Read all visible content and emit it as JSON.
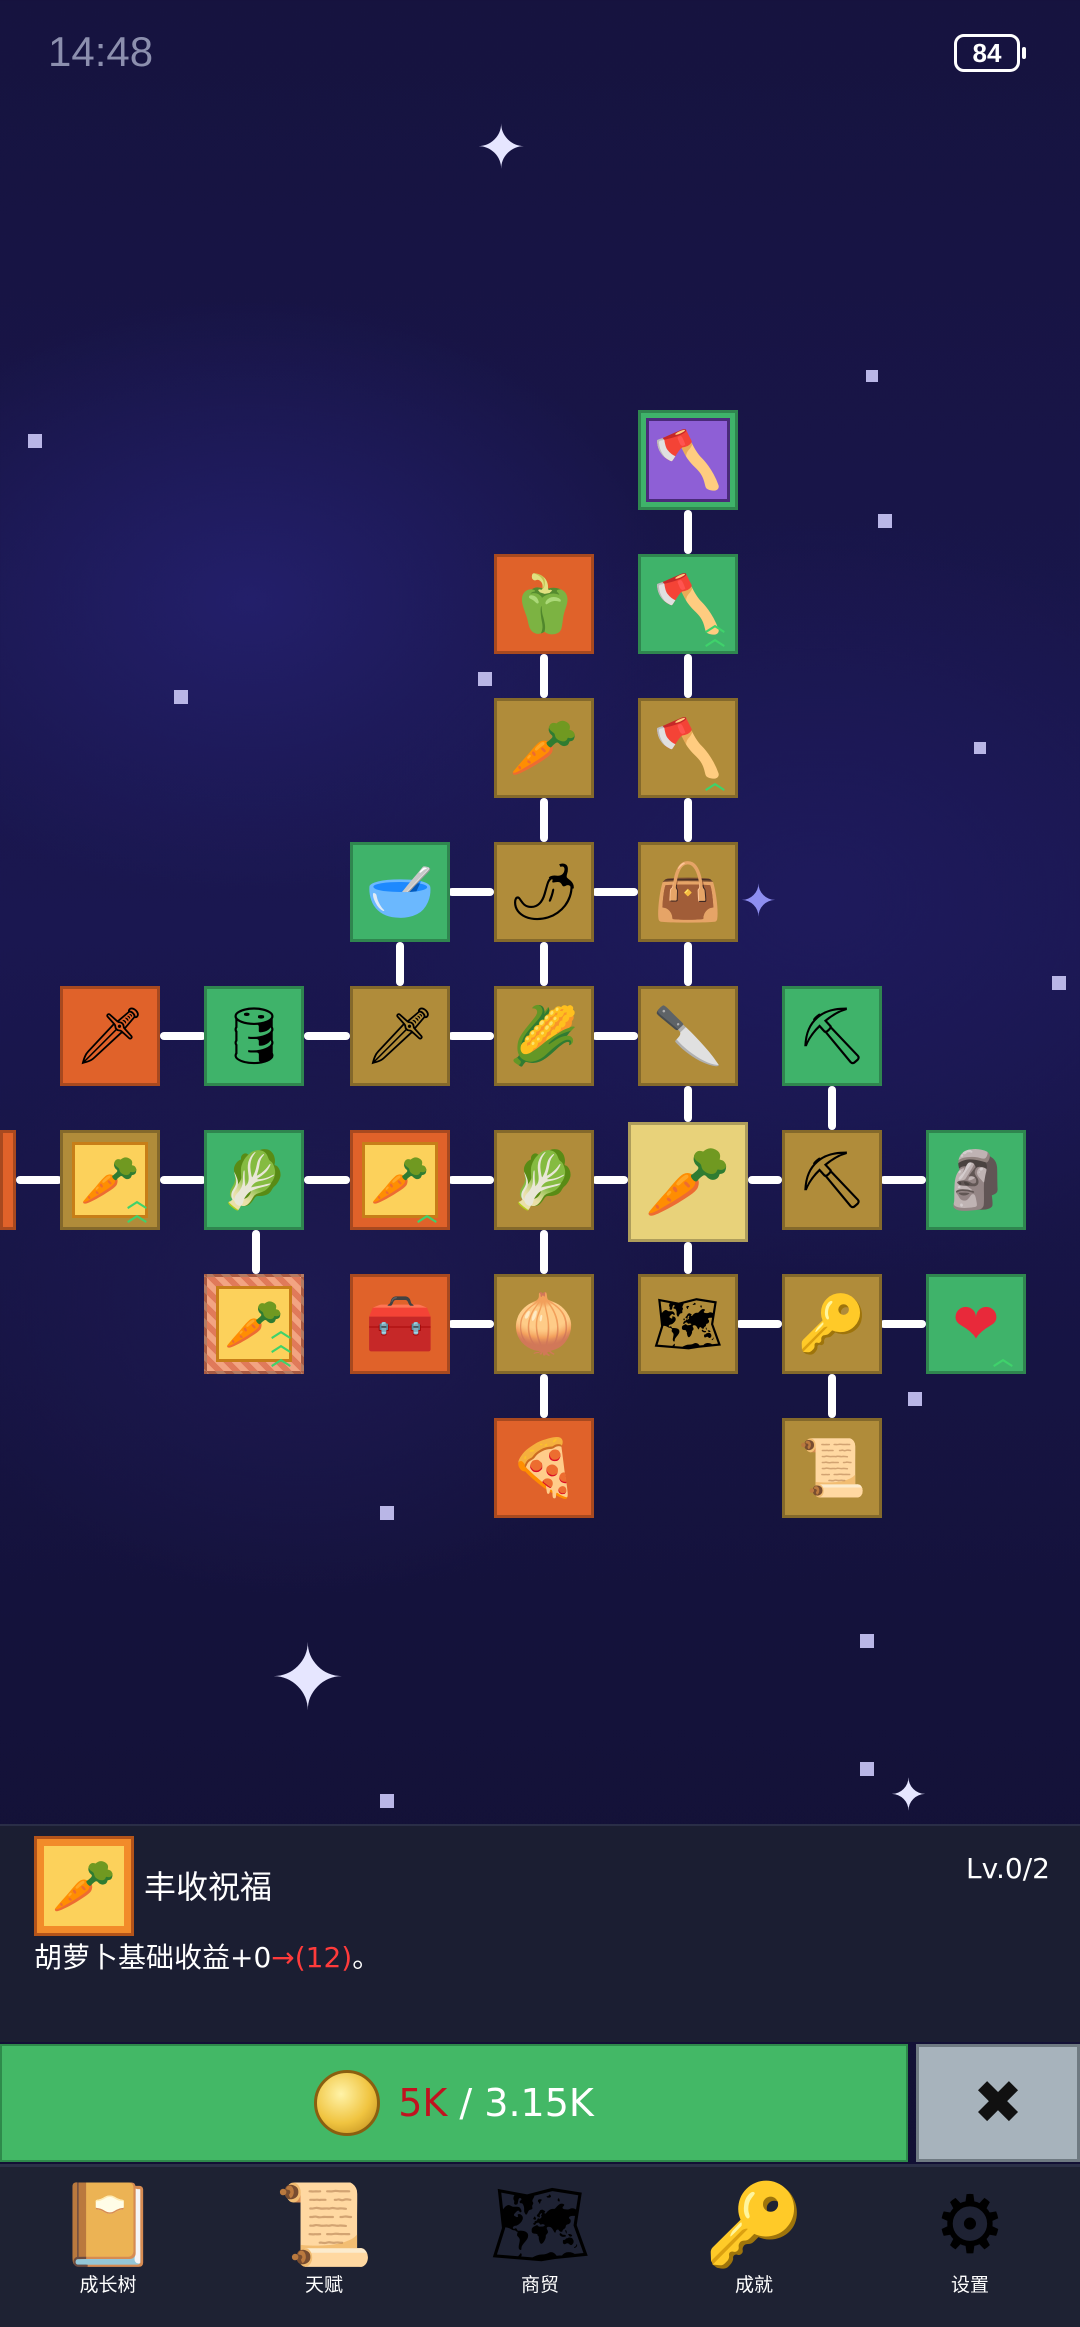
{
  "status_bar": {
    "time": "14:48",
    "battery": "84"
  },
  "panel": {
    "title": "丰收祝福",
    "level": "Lv.0/2",
    "desc_prefix": "胡萝卜基础收益+0",
    "desc_arrow": "→",
    "desc_value": "(12)",
    "desc_suffix": "。"
  },
  "upgrade": {
    "cost_needed": "5K",
    "separator": " / ",
    "coins_owned": "3.15K"
  },
  "close_label": "✖",
  "nav": [
    {
      "label": "成长树",
      "icon": "book-icon"
    },
    {
      "label": "天赋",
      "icon": "scroll-icon"
    },
    {
      "label": "商贸",
      "icon": "map-icon"
    },
    {
      "label": "成就",
      "icon": "key-icon"
    },
    {
      "label": "设置",
      "icon": "gear-icon"
    }
  ],
  "tree_nodes": [
    {
      "id": "shovel-purple",
      "icon": "🪓",
      "color": "purple"
    },
    {
      "id": "pepper",
      "icon": "🫑",
      "color": "orange"
    },
    {
      "id": "shovel-2",
      "icon": "🪓",
      "color": "green"
    },
    {
      "id": "radish",
      "icon": "🥕",
      "color": "gold"
    },
    {
      "id": "shovel-1",
      "icon": "🪓",
      "color": "gold"
    },
    {
      "id": "pot",
      "icon": "🥣",
      "color": "green"
    },
    {
      "id": "chili",
      "icon": "🌶",
      "color": "gold"
    },
    {
      "id": "bag",
      "icon": "👜",
      "color": "gold"
    },
    {
      "id": "sword-1",
      "icon": "🗡",
      "color": "orange"
    },
    {
      "id": "barrel",
      "icon": "🛢",
      "color": "green"
    },
    {
      "id": "sword-2",
      "icon": "🗡",
      "color": "gold"
    },
    {
      "id": "corn",
      "icon": "🌽",
      "color": "gold"
    },
    {
      "id": "knife",
      "icon": "🔪",
      "color": "gold"
    },
    {
      "id": "pickaxe-1",
      "icon": "⛏",
      "color": "green"
    },
    {
      "id": "carrot-boost-1",
      "icon": "🥕",
      "color": "gold"
    },
    {
      "id": "cabbage-1",
      "icon": "🥬",
      "color": "green"
    },
    {
      "id": "carrot-boost-2",
      "icon": "🥕",
      "color": "orange"
    },
    {
      "id": "cabbage-2",
      "icon": "🥬",
      "color": "gold"
    },
    {
      "id": "carrot-center",
      "icon": "🥕",
      "color": "highlight"
    },
    {
      "id": "pickaxe-2",
      "icon": "⛏",
      "color": "gold"
    },
    {
      "id": "statue",
      "icon": "🗿",
      "color": "green"
    },
    {
      "id": "carrot-boost-selected",
      "icon": "🥕",
      "color": "striped"
    },
    {
      "id": "chest",
      "icon": "🧰",
      "color": "orange"
    },
    {
      "id": "leek",
      "icon": "🧅",
      "color": "gold"
    },
    {
      "id": "map",
      "icon": "🗺",
      "color": "gold"
    },
    {
      "id": "key",
      "icon": "🔑",
      "color": "gold"
    },
    {
      "id": "heart",
      "icon": "❤",
      "color": "green"
    },
    {
      "id": "pizza",
      "icon": "🍕",
      "color": "orange"
    },
    {
      "id": "scroll",
      "icon": "📜",
      "color": "gold"
    }
  ]
}
